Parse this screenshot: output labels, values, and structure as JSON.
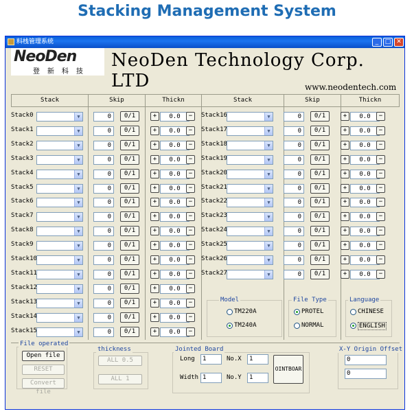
{
  "page_title": "Stacking Management System",
  "window": {
    "title": "料栈管理系统",
    "min": "_",
    "max": "□",
    "close": "✕"
  },
  "logo": {
    "text": "NeoDen",
    "chinese": "登新科技"
  },
  "company": "NeoDen Technology Corp. LTD",
  "website": "www.neodentech.com",
  "headers": {
    "stack": "Stack",
    "skip": "Skip",
    "thickness": "Thickn"
  },
  "left_stacks": [
    "Stack0",
    "Stack1",
    "Stack2",
    "Stack3",
    "Stack4",
    "Stack5",
    "Stack6",
    "Stack7",
    "Stack8",
    "Stack9",
    "Stack10",
    "Stack11",
    "Stack12",
    "Stack13",
    "Stack14",
    "Stack15"
  ],
  "right_stacks": [
    "Stack16",
    "Stack17",
    "Stack18",
    "Stack19",
    "Stack20",
    "Stack21",
    "Stack22",
    "Stack23",
    "Stack24",
    "Stack25",
    "Stack26",
    "Stack27"
  ],
  "skip_value": "0",
  "toggle_label": "0/1",
  "thickness_value": "0.0",
  "plus": "+",
  "minus": "−",
  "model": {
    "label": "Model",
    "options": [
      "TM220A",
      "TM240A"
    ],
    "selected": "TM240A"
  },
  "file_type": {
    "label": "File Type",
    "options": [
      "PROTEL",
      "NORMAL"
    ],
    "selected": "PROTEL"
  },
  "language": {
    "label": "Language",
    "options": [
      "CHINESE",
      "ENGLISH"
    ],
    "selected": "ENGLISH"
  },
  "file_operated": {
    "label": "File operated",
    "open": "Open file",
    "reset": "RESET",
    "convert": "Convert file"
  },
  "thickness_group": {
    "label": "thickness",
    "all05": "ALL 0.5",
    "all1": "ALL 1"
  },
  "jointed": {
    "label": "Jointed Board",
    "long_label": "Long",
    "long_value": "1",
    "width_label": "Width",
    "width_value": "1",
    "nox_label": "No.X",
    "nox_value": "1",
    "noy_label": "No.Y",
    "noy_value": "1",
    "button": "OINTBOAR"
  },
  "xy_offset": {
    "label": "X-Y Origin Offset",
    "x": "0",
    "y": "0"
  }
}
